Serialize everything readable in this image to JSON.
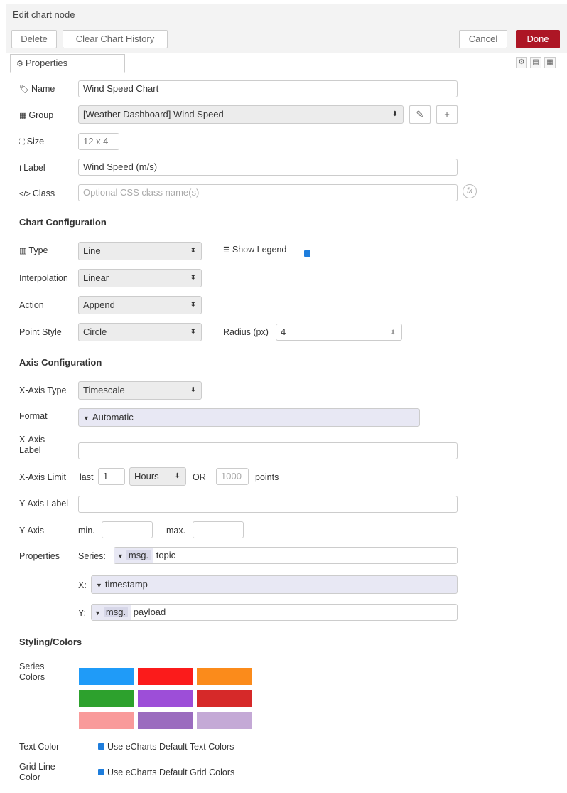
{
  "header": {
    "title": "Edit chart node"
  },
  "toolbar": {
    "delete": "Delete",
    "clear": "Clear Chart History",
    "cancel": "Cancel",
    "done": "Done"
  },
  "tab": {
    "label": "Properties"
  },
  "fields": {
    "name": {
      "label": "Name",
      "value": "Wind Speed Chart"
    },
    "group": {
      "label": "Group",
      "value": "[Weather Dashboard] Wind Speed"
    },
    "size": {
      "label": "Size",
      "value": "12 x 4"
    },
    "label": {
      "label": "Label",
      "value": "Wind Speed (m/s)"
    },
    "class": {
      "label": "Class",
      "placeholder": "Optional CSS class name(s)"
    }
  },
  "chart_config": {
    "title": "Chart Configuration",
    "type": {
      "label": "Type",
      "value": "Line"
    },
    "show_legend": {
      "label": "Show Legend",
      "checked": true
    },
    "interpolation": {
      "label": "Interpolation",
      "value": "Linear"
    },
    "action": {
      "label": "Action",
      "value": "Append"
    },
    "point_style": {
      "label": "Point Style",
      "value": "Circle"
    },
    "radius": {
      "label": "Radius (px)",
      "value": "4"
    }
  },
  "axis_config": {
    "title": "Axis Configuration",
    "x_type": {
      "label": "X-Axis Type",
      "value": "Timescale"
    },
    "format": {
      "label": "Format",
      "value": "Automatic"
    },
    "x_label": {
      "label_line1": "X-Axis",
      "label_line2": "Label",
      "value": ""
    },
    "x_limit": {
      "label": "X-Axis Limit",
      "last": "last",
      "count": "1",
      "unit": "Hours",
      "or": "OR",
      "points": "1000",
      "points_label": "points"
    },
    "y_label": {
      "label": "Y-Axis Label",
      "value": ""
    },
    "y_axis": {
      "label": "Y-Axis",
      "min": "min.",
      "max": "max."
    },
    "properties": {
      "label": "Properties",
      "series_label": "Series:",
      "series_prefix": "msg.",
      "series_value": "topic",
      "x_label": "X:",
      "x_value": "timestamp",
      "y_label": "Y:",
      "y_prefix": "msg.",
      "y_value": "payload"
    }
  },
  "styling": {
    "title": "Styling/Colors",
    "series_label_line1": "Series",
    "series_label_line2": "Colors",
    "colors": [
      "#1f9bf8",
      "#fb1b1b",
      "#fb8b1b",
      "#2da12d",
      "#9d4ed8",
      "#d62929",
      "#f99a9a",
      "#9b6cbf",
      "#c4a9d6"
    ],
    "text_color": {
      "label": "Text Color",
      "option": "Use eCharts Default Text Colors",
      "checked": true
    },
    "grid_color": {
      "label_line1": "Grid Line",
      "label_line2": "Color",
      "option": "Use eCharts Default Grid Colors",
      "checked": true
    }
  }
}
